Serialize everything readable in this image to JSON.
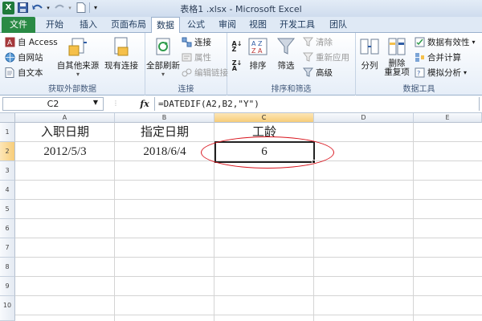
{
  "window": {
    "title": "表格1 .xlsx - Microsoft Excel"
  },
  "tabs": [
    "文件",
    "开始",
    "插入",
    "页面布局",
    "数据",
    "公式",
    "审阅",
    "视图",
    "开发工具",
    "团队"
  ],
  "ribbon": {
    "external": {
      "label": "获取外部数据",
      "access": "自 Access",
      "web": "自网站",
      "text": "自文本",
      "other": "自其他来源",
      "existing": "现有连接"
    },
    "connections": {
      "label": "连接",
      "refresh_all": "全部刷新",
      "connections": "连接",
      "properties": "属性",
      "edit_links": "编辑链接"
    },
    "sort_filter": {
      "label": "排序和筛选",
      "sort": "排序",
      "filter": "筛选",
      "clear": "清除",
      "reapply": "重新应用",
      "advanced": "高级"
    },
    "data_tools": {
      "label": "数据工具",
      "split": "分列",
      "remove_dup_1": "删除",
      "remove_dup_2": "重复项",
      "validation": "数据有效性",
      "consolidate": "合并计算",
      "what_if": "模拟分析"
    }
  },
  "formula_bar": {
    "name_box": "C2",
    "fx": "fx",
    "formula": "=DATEDIF(A2,B2,\"Y\")"
  },
  "sheet": {
    "columns": [
      "A",
      "B",
      "C",
      "D",
      "E"
    ],
    "rows": [
      "1",
      "2",
      "3",
      "4",
      "5",
      "6",
      "7",
      "8",
      "9",
      "10"
    ],
    "cells": {
      "A1": "入职日期",
      "B1": "指定日期",
      "C1": "工龄",
      "A2": "2012/5/3",
      "B2": "2018/6/4",
      "C2": "6"
    },
    "selected": "C2"
  },
  "colors": {
    "file_tab": "#2a8a45",
    "annotation_oval": "#d9151e",
    "selection": "#f7cd79"
  }
}
